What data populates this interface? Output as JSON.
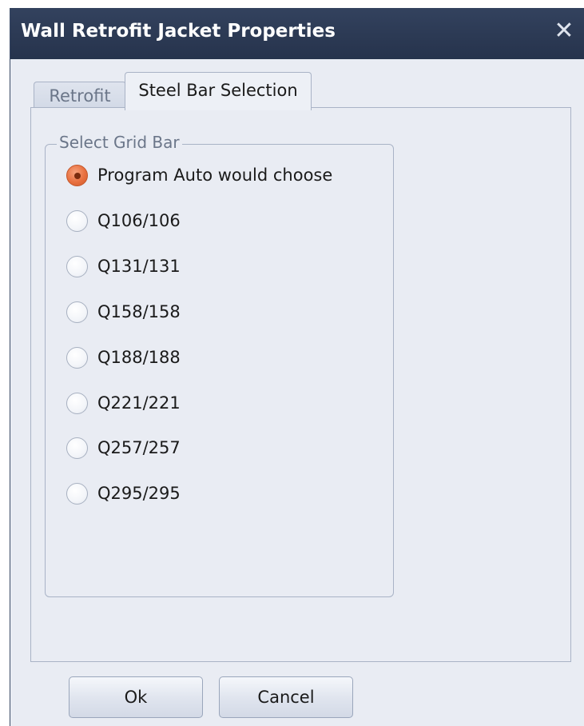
{
  "window": {
    "title": "Wall Retrofit Jacket Properties",
    "close_glyph": "✕"
  },
  "tabs": [
    {
      "label": "Retrofit",
      "active": false
    },
    {
      "label": "Steel Bar Selection",
      "active": true
    }
  ],
  "group": {
    "title": "Select Grid Bar",
    "options": [
      {
        "label": "Program Auto would choose",
        "checked": true
      },
      {
        "label": "Q106/106",
        "checked": false
      },
      {
        "label": "Q131/131",
        "checked": false
      },
      {
        "label": "Q158/158",
        "checked": false
      },
      {
        "label": "Q188/188",
        "checked": false
      },
      {
        "label": "Q221/221",
        "checked": false
      },
      {
        "label": "Q257/257",
        "checked": false
      },
      {
        "label": "Q295/295",
        "checked": false
      }
    ]
  },
  "buttons": {
    "ok": "Ok",
    "cancel": "Cancel"
  },
  "colors": {
    "titlebar": "#2c3a55",
    "window_bg": "#e9ecf3",
    "radio_selected": "#e8703f"
  }
}
